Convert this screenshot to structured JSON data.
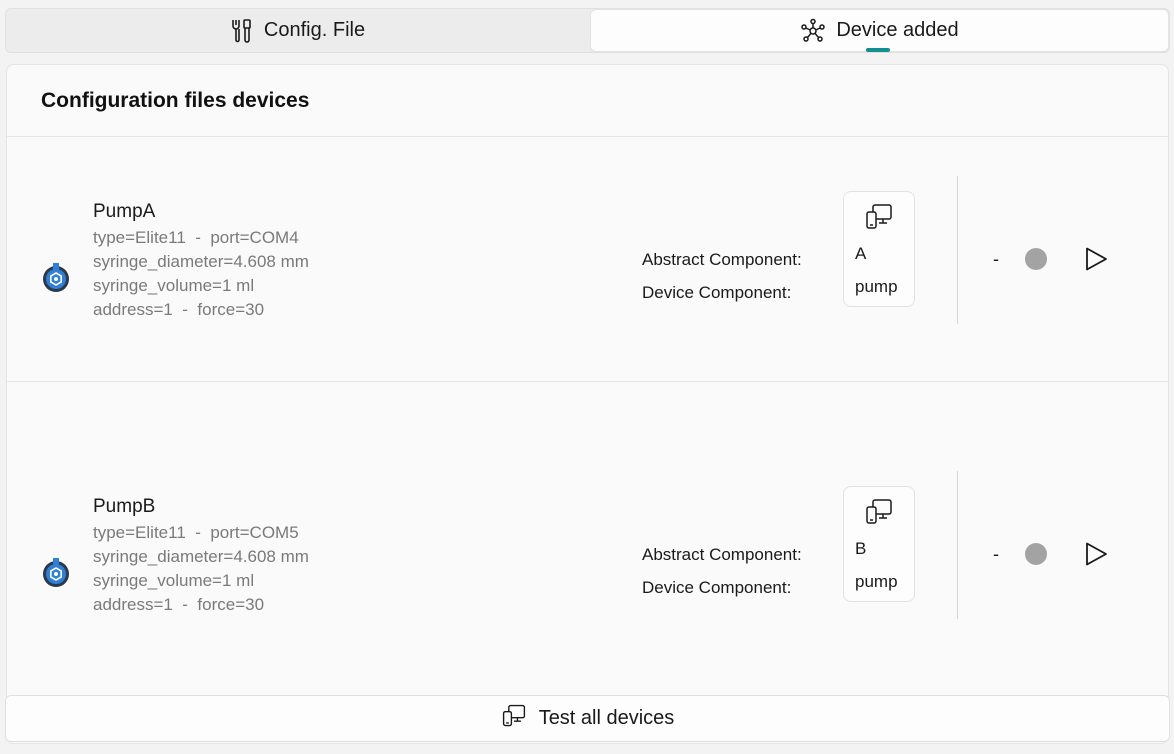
{
  "tabs": {
    "config_label": "Config. File",
    "device_label": "Device added"
  },
  "panel": {
    "title": "Configuration files devices"
  },
  "devices": [
    {
      "name": "PumpA",
      "details": [
        "type=Elite11  -  port=COM4",
        "syringe_diameter=4.608 mm",
        "syringe_volume=1 ml",
        "address=1  -  force=30"
      ],
      "abstract_label": "Abstract Component:",
      "device_label": "Device Component:",
      "abstract_value": "A",
      "device_value": "pump",
      "status_text": "-",
      "status_color": "#a3a3a3"
    },
    {
      "name": "PumpB",
      "details": [
        "type=Elite11  -  port=COM5",
        "syringe_diameter=4.608 mm",
        "syringe_volume=1 ml",
        "address=1  -  force=30"
      ],
      "abstract_label": "Abstract Component:",
      "device_label": "Device Component:",
      "abstract_value": "B",
      "device_value": "pump",
      "status_text": "-",
      "status_color": "#a3a3a3"
    }
  ],
  "footer": {
    "test_all_label": "Test all devices"
  },
  "colors": {
    "accent": "#138f8f",
    "device_icon": "#2f7fd6"
  }
}
